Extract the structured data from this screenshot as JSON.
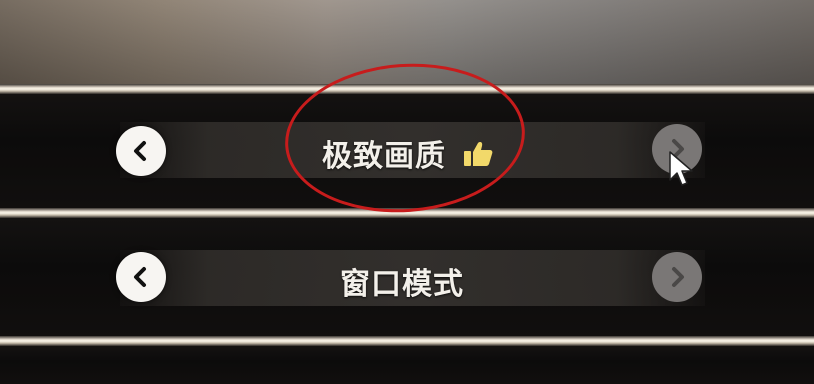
{
  "settings": {
    "rows": [
      {
        "value_label": "极致画质",
        "has_thumb": true
      },
      {
        "value_label": "窗口模式",
        "has_thumb": false
      }
    ]
  },
  "icons": {
    "prev": "chevron-left-icon",
    "next": "chevron-right-icon",
    "recommend": "thumbs-up-icon",
    "pointer": "mouse-cursor-icon"
  },
  "colors": {
    "annotation_circle": "#c71c1c",
    "thumb_icon": "#f2d96a",
    "label_text": "#f3f0ea"
  }
}
